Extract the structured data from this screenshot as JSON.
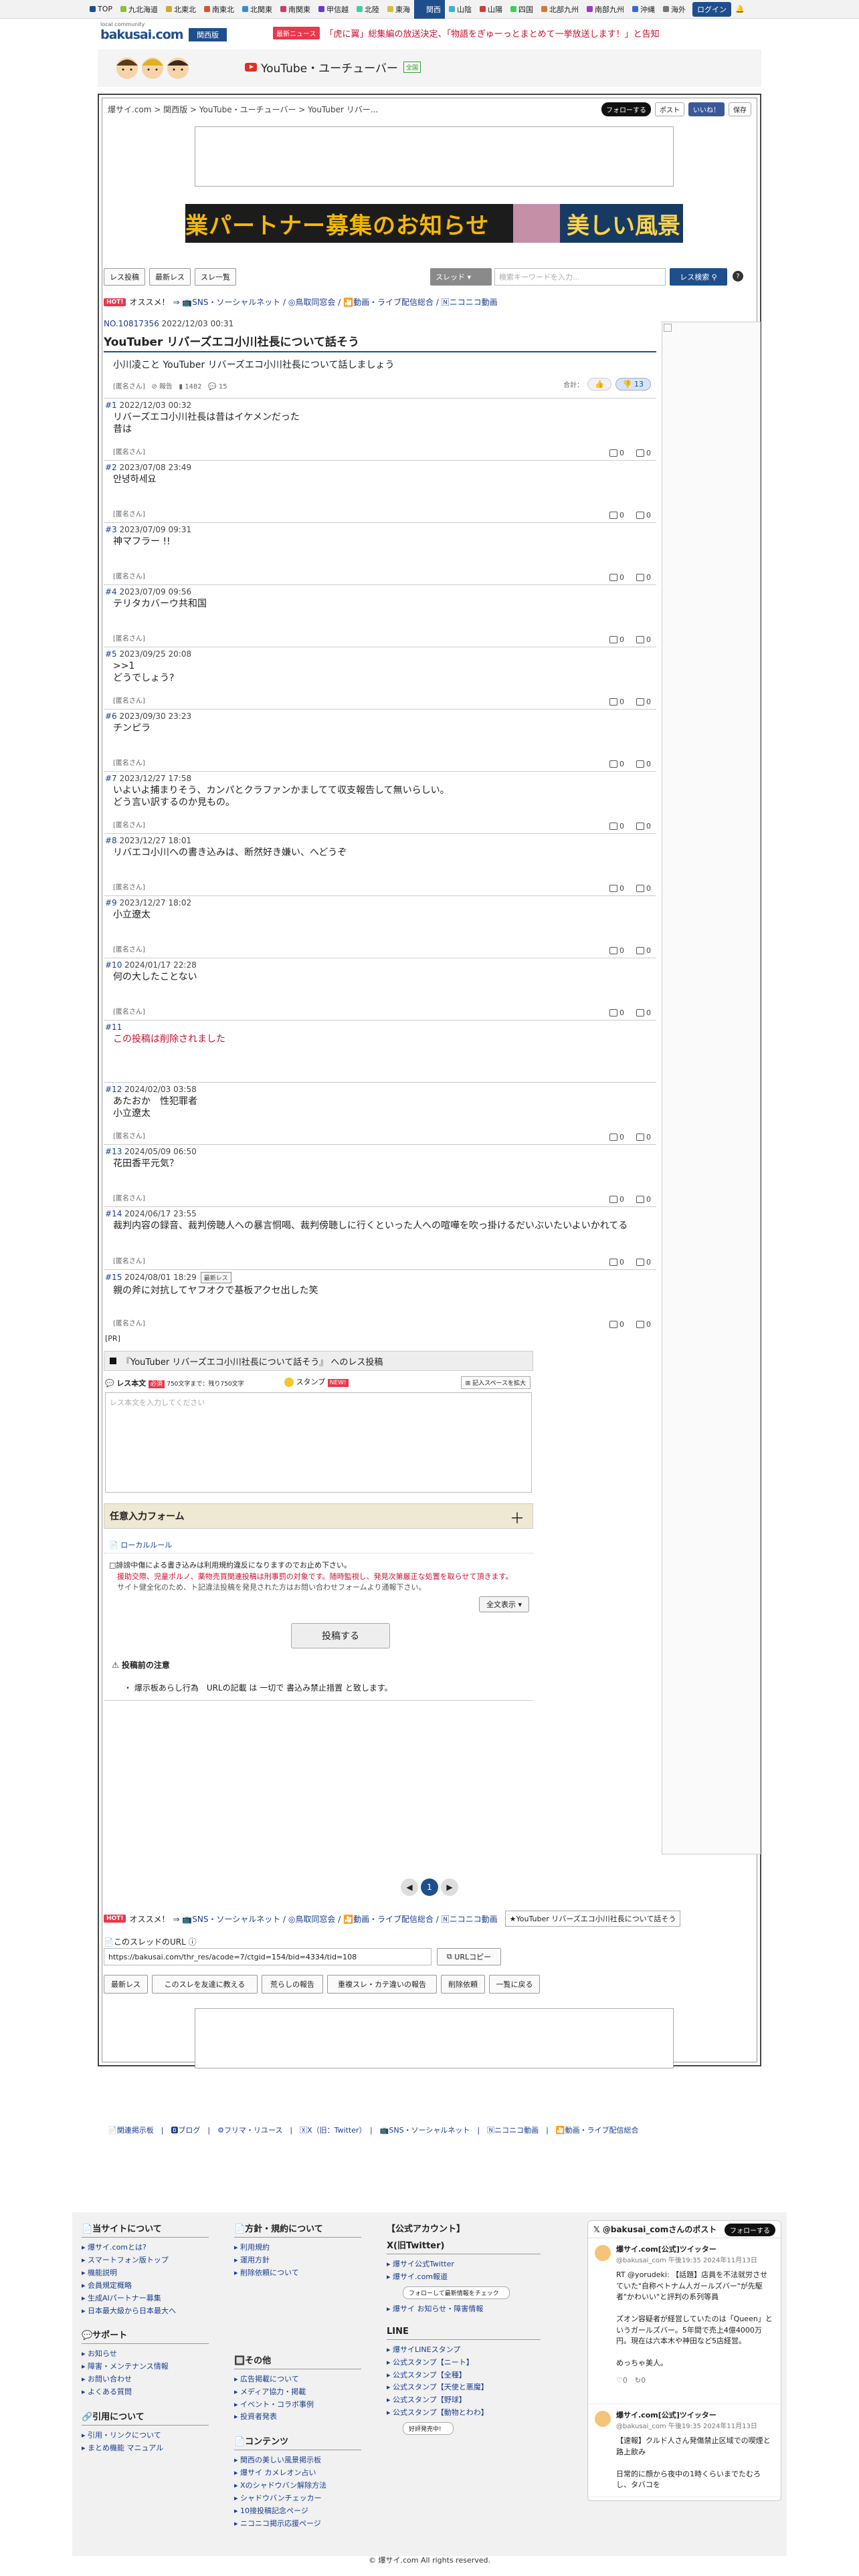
{
  "topnav": {
    "items": [
      {
        "label": "TOP",
        "color": "#1f4e8c"
      },
      {
        "label": "九北海道",
        "color": "#8bbf3a"
      },
      {
        "label": "北東北",
        "color": "#d0a53a"
      },
      {
        "label": "南東北",
        "color": "#d0573a"
      },
      {
        "label": "北関東",
        "color": "#3a8bd0"
      },
      {
        "label": "南関東",
        "color": "#d03a6a"
      },
      {
        "label": "甲信越",
        "color": "#6a3ad0"
      },
      {
        "label": "北陸",
        "color": "#3ad0a5"
      },
      {
        "label": "東海",
        "color": "#d0c23a"
      },
      {
        "label": "関西",
        "color": "#1f4e8c"
      },
      {
        "label": "山陰",
        "color": "#3ab6d0"
      },
      {
        "label": "山陽",
        "color": "#d03a3a"
      },
      {
        "label": "四国",
        "color": "#3ad05e"
      },
      {
        "label": "北部九州",
        "color": "#d07a3a"
      },
      {
        "label": "南部九州",
        "color": "#9a3ad0"
      },
      {
        "label": "沖縄",
        "color": "#3a6ad0"
      },
      {
        "label": "海外",
        "color": "#777777"
      }
    ],
    "login": "ログイン"
  },
  "header": {
    "logo_small": "local community",
    "logo": "bakusai.com",
    "region": "関西版",
    "news_badge": "最新ニュース",
    "news_text": "「虎に翼」総集編の放送決定、「物語をぎゅーっとまとめて一挙放送します！」と告知"
  },
  "category": {
    "title": "YouTube・ユーチューバー",
    "tag": "全国"
  },
  "breadcrumb": "爆サイ.com > 関西版 > YouTube・ユーチューバー > YouTuber リバー...",
  "share": {
    "follow": "フォローする",
    "post": "ポスト",
    "like": "いいね！",
    "save": "保存"
  },
  "banner": {
    "left": "業パートナー募集のお知らせ",
    "right": "美しい風景"
  },
  "toolbar": {
    "btn_post": "レス投稿",
    "btn_latest": "最新レス",
    "btn_list": "スレ一覧",
    "select": "スレッド",
    "search_placeholder": "検索キーワードを入力...",
    "search_btn": "レス検索",
    "help": "?"
  },
  "hot": {
    "badge": "HOT!",
    "label": "オススメ！",
    "links": "⇒ 📺SNS・ソーシャルネット / ◎鳥取同窓会 / 🎦動画・ライブ配信総合 / 🄽ニコニコ動画"
  },
  "thread": {
    "no": "NO.10817356",
    "date": "2022/12/03 00:31",
    "title": "YouTuber リバーズエコ小川社長について話そう",
    "body": "小川凌こと YouTuber リバーズエコ小川社長について話しましょう",
    "name": "[匿名さん]",
    "report": "報告",
    "views": "1482",
    "comments": "15",
    "vote_label": "合計：",
    "vote_up": "",
    "vote_down": "13"
  },
  "posts": [
    {
      "no": "#1",
      "date": "2022/12/03 00:32",
      "text": "リバーズエコ小川社長は昔はイケメンだった\n昔は",
      "name": "[匿名さん]",
      "up": "0",
      "down": "0"
    },
    {
      "no": "#2",
      "date": "2023/07/08 23:49",
      "text": "안녕하세요",
      "name": "[匿名さん]",
      "up": "0",
      "down": "0"
    },
    {
      "no": "#3",
      "date": "2023/07/09 09:31",
      "text": "神マフラー !!",
      "name": "[匿名さん]",
      "up": "0",
      "down": "0"
    },
    {
      "no": "#4",
      "date": "2023/07/09 09:56",
      "text": "テリタカバーウ共和国",
      "name": "[匿名さん]",
      "up": "0",
      "down": "0"
    },
    {
      "no": "#5",
      "date": "2023/09/25 20:08",
      "text": ">>1\nどうでしょう?",
      "name": "[匿名さん]",
      "up": "0",
      "down": "0"
    },
    {
      "no": "#6",
      "date": "2023/09/30 23:23",
      "text": "チンピラ",
      "name": "[匿名さん]",
      "up": "0",
      "down": "0"
    },
    {
      "no": "#7",
      "date": "2023/12/27 17:58",
      "text": "いよいよ捕まりそう、カンパとクラファンかましてて収支報告して無いらしい。\nどう言い訳するのか見もの。",
      "name": "[匿名さん]",
      "up": "0",
      "down": "0"
    },
    {
      "no": "#8",
      "date": "2023/12/27 18:01",
      "text": "リバエコ小川への書き込みは、断然好き嫌い、へどうぞ",
      "name": "[匿名さん]",
      "up": "0",
      "down": "0"
    },
    {
      "no": "#9",
      "date": "2023/12/27 18:02",
      "text": "小立遼太",
      "name": "[匿名さん]",
      "up": "0",
      "down": "0"
    },
    {
      "no": "#10",
      "date": "2024/01/17 22:28",
      "text": "何の大したことない",
      "name": "[匿名さん]",
      "up": "0",
      "down": "0"
    },
    {
      "no": "#11",
      "date": "",
      "text": "この投稿は削除されました",
      "name": "",
      "up": "",
      "down": "",
      "deleted": true
    },
    {
      "no": "#12",
      "date": "2024/02/03 03:58",
      "text": "あたおか　性犯罪者\n小立遼太",
      "name": "[匿名さん]",
      "up": "0",
      "down": "0"
    },
    {
      "no": "#13",
      "date": "2024/05/09 06:50",
      "text": "花田香平元気？",
      "name": "[匿名さん]",
      "up": "0",
      "down": "0"
    },
    {
      "no": "#14",
      "date": "2024/06/17 23:55",
      "text": "裁判内容の録音、裁判傍聴人への暴言恫喝、裁判傍聴しに行くといった人への喧嘩を吹っ掛けるだいぶいたいよいかれてる",
      "name": "[匿名さん]",
      "up": "0",
      "down": "0"
    },
    {
      "no": "#15",
      "date": "2024/08/01 18:29",
      "text": "親の斧に対抗してヤフオクで基板アクセ出した笑",
      "name": "[匿名さん]",
      "up": "0",
      "down": "0",
      "newtag": "最新レス"
    }
  ],
  "pr": "[PR]",
  "form": {
    "title": "『YouTuber リバーズエコ小川社長について話そう』 へのレス投稿",
    "label": "レス本文",
    "required": "必須",
    "limit": "750文字まで：残り750文字",
    "stamp": "スタンプ",
    "new": "NEW!",
    "expand": "記入スペースを拡大",
    "placeholder": "レス本文を入力してください",
    "optional": "任意入力フォーム",
    "plus": "＋",
    "local_rule": "📄 ローカルルール",
    "rule1": "□誹謗中傷による書き込みは利用規約違反になりますのでお止め下さい。",
    "rule2": "援助交際、児童ポルノ、薬物売買関連投稿は刑事罰の対象です。随時監視し、発見次第厳正な処置を取らせて頂きます。",
    "rule3": "サイト健全化のため、ト記違法投稿を発見された方はお問い合わせフォームより通報下さい。",
    "show_all": "全文表示 ▾",
    "submit": "投稿する",
    "caution_title": "⚠ 投稿前の注意",
    "caution_text": "・ 爆示板あらし行為　URLの記載 は 一切で 書込み禁止措置 と致します。"
  },
  "pager": {
    "prev": "◀",
    "current": "1",
    "next": "▶"
  },
  "bottom_hot": {
    "badge": "HOT!",
    "label": "オススメ！",
    "links": "⇒ 📺SNS・ソーシャルネット / ◎鳥取同窓会 / 🎦動画・ライブ配信総合 / 🄽ニコニコ動画",
    "related": "★YouTuber リバーズエコ小川社長について話そう"
  },
  "url_section": {
    "label": "📄このスレッドのURL ⓘ",
    "url": "https://bakusai.com/thr_res/acode=7/ctgid=154/bid=4334/tid=108",
    "copy": "URLコピー"
  },
  "bottom_buttons": [
    "最新レス",
    "このスレを友達に教える",
    "荒らしの報告",
    "重複スレ・カテ違いの報告",
    "削除依頼",
    "一覧に戻る"
  ],
  "footer_links": "📄関連掲示板　|　🅱ブログ　|　⚙フリマ・リユース　|　🅇X（旧：Twitter）　|　📺SNS・ソーシャルネット　|　🄽ニコニコ動画　|　🎦動画・ライブ配信総合",
  "footer": {
    "col1": {
      "h1": "📄当サイトについて",
      "items1": [
        "爆サイ.comとは?",
        "スマートフォン版トップ",
        "機能説明",
        "会員規定概略",
        "生成AIパートナー募集",
        "日本最大級から日本最大へ"
      ],
      "h2": "💬サポート",
      "items2": [
        "お知らせ",
        "障害・メンテナンス情報",
        "お問い合わせ",
        "よくある質問"
      ],
      "h3": "🔗引用について",
      "items3": [
        "引用・リンクについて",
        "まとめ機能 マニュアル"
      ]
    },
    "col2": {
      "h1": "📄方針・規約について",
      "items1": [
        "利用規約",
        "運用方針",
        "削除依頼について"
      ],
      "h2": "🔲その他",
      "items2": [
        "広告掲載について",
        "メディア協力・掲載",
        "イベント・コラボ事例",
        "投資者発表"
      ],
      "h3": "📄コンテンツ",
      "items3": [
        "関西の美しい風景掲示板",
        "爆サイ カメレオン占い",
        "Xのシャドウバン解除方法",
        "シャドウバンチェッカー",
        "10接投稿記念ページ",
        "ニコニコ掲示応援ページ"
      ]
    },
    "col3": {
      "h1": "【公式アカウント】",
      "sub1": "X(旧Twitter)",
      "items1": [
        "爆サイ公式Twitter",
        "爆サイ.com報道"
      ],
      "follow": "フォローして最新情報をチェック",
      "items1b": [
        "爆サイ お知らせ・障害情報"
      ],
      "h2": "LINE",
      "items2": [
        "爆サイLINEスタンプ",
        "公式スタンプ【ニート】",
        "公式スタンプ【全種】",
        "公式スタンプ【天使と悪魔】",
        "公式スタンプ【野球】",
        "公式スタンプ【動物とわわ】"
      ],
      "sale": "好評発売中!"
    },
    "twitter": {
      "title": "@bakusai_comさんのポスト",
      "follow": "フォローする",
      "t1_name": "爆サイ.com[公式]ツイッター",
      "t1_handle": "@bakusai_com 午後19:35 2024年11月13日",
      "t1_text": "RT @yorudeki: 【話題】店員を不法就労させていた\"自称ベトナム人ガールズバー\"が先駆者\"かわいい\"と評判の系列等員\n\nズオン容疑者が経営していたのは「Queen」というガールズバー。5年間で売上4億4000万円。現在は六本木や神田など5店経営。\n\nめっちゃ美人。",
      "t1_stats": "♡0　↻0",
      "t2_name": "爆サイ.com[公式]ツイッター",
      "t2_handle": "@bakusai_com 午後19:35 2024年11月13日",
      "t2_text": "【速報】クルド人さん発傷禁止区域での喫煙と路上飲み\n\n日常的に顔から夜中の1時くらいまでたむろし、タバコを"
    }
  },
  "copyright": "© 爆サイ.com All rights reserved."
}
